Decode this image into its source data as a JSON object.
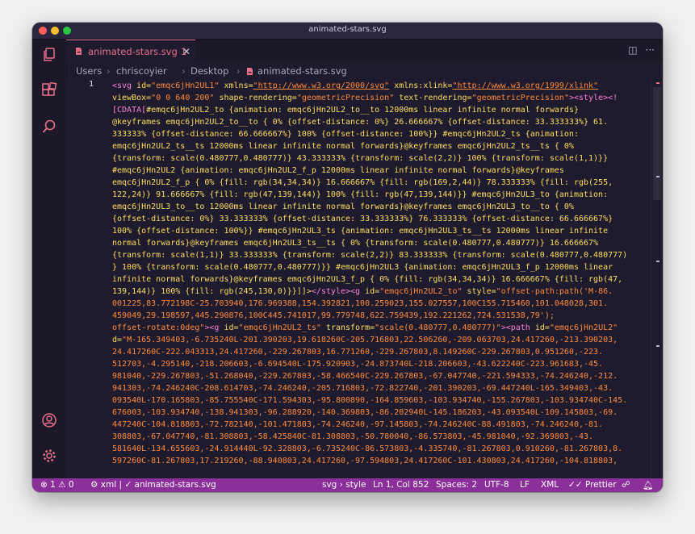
{
  "window": {
    "title": "animated-stars.svg"
  },
  "tab": {
    "label": "animated-stars.svg",
    "problems": "1",
    "close": "✕"
  },
  "breadcrumb": [
    "Users",
    "chriscoyier",
    "Desktop",
    "animated-stars.svg"
  ],
  "editor": {
    "line_number": "1"
  },
  "status": {
    "errors": "1",
    "warnings": "0",
    "language_check": "xml |",
    "file": "animated-stars.svg",
    "scope": "svg › style",
    "position": "Ln 1, Col 852",
    "spaces": "Spaces: 2",
    "encoding": "UTF-8",
    "eol": "LF",
    "mode": "XML",
    "prettier": "Prettier"
  },
  "code": {
    "l01a": "<svg ",
    "l01b": "id=",
    "l01c": "\"emqc6jHn2UL1\" ",
    "l01d": "xmlns=",
    "l01e": "\"http://www.w3.org/2000/svg\"",
    "l01f": " xmlns:xlink=",
    "l01g": "\"http://www.w3.org/1999/xlink\"",
    "l02a": "viewBox=",
    "l02b": "\"0 0 640 200\"",
    "l02c": " shape-rendering=",
    "l02d": "\"geometricPrecision\"",
    "l02e": " text-rendering=",
    "l02f": "\"geometricPrecision\"",
    "l02g": "><style><!",
    "l03a": "[CDATA[",
    "l03b": "#emqc6jHn2UL2_to {animation: emqc6jHn2UL2_to__to 12000ms linear infinite normal forwards}",
    "l04": "@keyframes emqc6jHn2UL2_to__to { 0% {offset-distance: 0%} 26.666667% {offset-distance: 33.333333%} 61.",
    "l05": "333333% {offset-distance: 66.666667%} 100% {offset-distance: 100%}} #emqc6jHn2UL2_ts {animation:",
    "l06": "emqc6jHn2UL2_ts__ts 12000ms linear infinite normal forwards}@keyframes emqc6jHn2UL2_ts__ts { 0%",
    "l07": "{transform: scale(0.480777,0.480777)} 43.333333% {transform: scale(2,2)} 100% {transform: scale(1,1)}}",
    "l08": "#emqc6jHn2UL2 {animation: emqc6jHn2UL2_f_p 12000ms linear infinite normal forwards}@keyframes",
    "l09": "emqc6jHn2UL2_f_p { 0% {fill: rgb(34,34,34)} 16.666667% {fill: rgb(169,2,44)} 78.333333% {fill: rgb(255,",
    "l10": "122,24)} 91.666667% {fill: rgb(47,139,144)} 100% {fill: rgb(47,139,144)}} #emqc6jHn2UL3_to {animation:",
    "l11": "emqc6jHn2UL3_to__to 12000ms linear infinite normal forwards}@keyframes emqc6jHn2UL3_to__to { 0%",
    "l12": "{offset-distance: 0%} 33.333333% {offset-distance: 33.333333%} 76.333333% {offset-distance: 66.666667%}",
    "l13": "100% {offset-distance: 100%}} #emqc6jHn2UL3_ts {animation: emqc6jHn2UL3_ts__ts 12000ms linear infinite",
    "l14": "normal forwards}@keyframes emqc6jHn2UL3_ts__ts { 0% {transform: scale(0.480777,0.480777)} 16.666667%",
    "l15": "{transform: scale(1,1)} 33.333333% {transform: scale(2,2)} 83.333333% {transform: scale(0.480777,0.480777)",
    "l16": "} 100% {transform: scale(0.480777,0.480777)}} #emqc6jHn2UL3 {animation: emqc6jHn2UL3_f_p 12000ms linear",
    "l17": "infinite normal forwards}@keyframes emqc6jHn2UL3_f_p { 0% {fill: rgb(34,34,34)} 16.666667% {fill: rgb(47,",
    "l18a": "139,144)} 100% {fill: rgb(245,130,0)}}]]>",
    "l18b": "</style><g ",
    "l18c": "id=",
    "l18d": "\"emqc6jHn2UL2_to\"",
    "l18e": " style=",
    "l18f": "\"offset-path:path('M-86.",
    "l19": "001225,83.772198C-25.703940,176.969388,154.392821,100.259023,155.027557,100C155.715460,101.048028,301.",
    "l20": "459049,29.198597,445.290876,100C445.741017,99.779748,622.759439,192.221262,724.531538,79');",
    "l21a": "offset-rotate:0deg\"",
    "l21b": "><g ",
    "l21c": "id=",
    "l21d": "\"emqc6jHn2UL2_ts\"",
    "l21e": " transform=",
    "l21f": "\"scale(0.480777,0.480777)\"",
    "l21g": "><path ",
    "l21h": "id=",
    "l21i": "\"emqc6jHn2UL2\"",
    "l22a": "d=",
    "l22b": "\"M-165.349403,-6.735240L-201.390203,19.618260C-205.716803,22.506260,-209.063703,24.417260,-213.390203,",
    "l23": "24.417260C-222.043313,24.417260,-229.267803,16.771260,-229.267803,8.149260C-229.267803,0.951260,-223.",
    "l24": "512703,-4.295140,-218.206603,-6.694540L-175.920903,-24.873740L-218.206603,-43.622240C-223.961683,-45.",
    "l25": "981040,-229.267803,-51.268040,-229.267803,-58.466540C-229.267803,-67.047740,-221.594333,-74.246240,-212.",
    "l26": "941303,-74.246240C-208.614703,-74.246240,-205.716803,-72.822740,-201.390203,-69.447240L-165.349403,-43.",
    "l27": "093540L-170.165803,-85.755540C-171.594303,-95.800890,-164.859603,-103.934740,-155.267803,-103.934740C-145.",
    "l28": "676003,-103.934740,-138.941303,-96.288920,-140.369803,-86.202940L-145.186203,-43.093540L-109.145803,-69.",
    "l29": "447240C-104.818803,-72.782140,-101.471803,-74.246240,-97.145803,-74.246240C-88.491803,-74.246240,-81.",
    "l30": "308803,-67.047740,-81.308803,-58.425840C-81.308803,-50.780040,-86.573803,-45.981040,-92.369803,-43.",
    "l31": "581640L-134.655603,-24.914440L-92.328803,-6.735240C-86.573803,-4.335740,-81.267803,0.910260,-81.267803,8.",
    "l32": "597260C-81.267803,17.219260,-88.940803,24.417260,-97.594803,24.417260C-101.430803,24.417260,-104.818803,"
  }
}
